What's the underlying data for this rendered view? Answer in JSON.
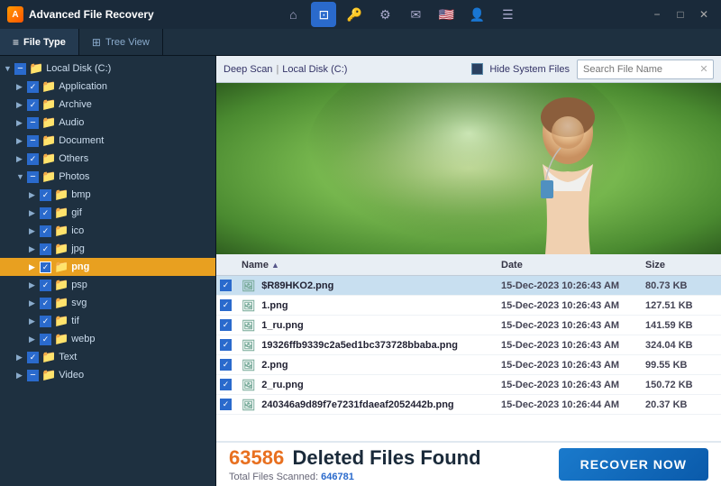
{
  "app": {
    "title": "Advanced File Recovery",
    "icon": "AFR"
  },
  "titlebar": {
    "nav": [
      {
        "name": "home-icon",
        "symbol": "⌂",
        "active": false
      },
      {
        "name": "scan-icon",
        "symbol": "⊡",
        "active": true
      },
      {
        "name": "key-icon",
        "symbol": "🔑",
        "active": false
      },
      {
        "name": "settings-icon",
        "symbol": "⚙",
        "active": false
      },
      {
        "name": "mail-icon",
        "symbol": "✉",
        "active": false
      }
    ],
    "win_controls": [
      "−",
      "□",
      "✕"
    ]
  },
  "tabs": [
    {
      "label": "File Type",
      "icon": "≡",
      "active": true
    },
    {
      "label": "Tree View",
      "icon": "⊞",
      "active": false
    }
  ],
  "toolbar": {
    "breadcrumb": [
      "Deep Scan",
      "Local Disk (C:)"
    ],
    "breadcrumb_sep": "|",
    "hide_sys_files_label": "Hide System Files",
    "search_placeholder": "Search File Name",
    "search_clear": "✕"
  },
  "tree": {
    "items": [
      {
        "id": "local-disk",
        "label": "Local Disk (C:)",
        "indent": 0,
        "expanded": true,
        "checked": "indeterminate",
        "type": "folder",
        "color": "yellow"
      },
      {
        "id": "application",
        "label": "Application",
        "indent": 1,
        "expanded": false,
        "checked": "checked",
        "type": "folder",
        "color": "yellow"
      },
      {
        "id": "archive",
        "label": "Archive",
        "indent": 1,
        "expanded": false,
        "checked": "checked",
        "type": "folder",
        "color": "yellow"
      },
      {
        "id": "audio",
        "label": "Audio",
        "indent": 1,
        "expanded": false,
        "checked": "indeterminate",
        "type": "folder",
        "color": "yellow"
      },
      {
        "id": "document",
        "label": "Document",
        "indent": 1,
        "expanded": false,
        "checked": "indeterminate",
        "type": "folder",
        "color": "yellow"
      },
      {
        "id": "others",
        "label": "Others",
        "indent": 1,
        "expanded": false,
        "checked": "checked",
        "type": "folder",
        "color": "yellow"
      },
      {
        "id": "photos",
        "label": "Photos",
        "indent": 1,
        "expanded": true,
        "checked": "indeterminate",
        "type": "folder",
        "color": "yellow"
      },
      {
        "id": "bmp",
        "label": "bmp",
        "indent": 2,
        "expanded": false,
        "checked": "checked",
        "type": "folder",
        "color": "yellow"
      },
      {
        "id": "gif",
        "label": "gif",
        "indent": 2,
        "expanded": false,
        "checked": "checked",
        "type": "folder",
        "color": "yellow"
      },
      {
        "id": "ico",
        "label": "ico",
        "indent": 2,
        "expanded": false,
        "checked": "checked",
        "type": "folder",
        "color": "yellow"
      },
      {
        "id": "jpg",
        "label": "jpg",
        "indent": 2,
        "expanded": false,
        "checked": "checked",
        "type": "folder",
        "color": "yellow"
      },
      {
        "id": "png",
        "label": "png",
        "indent": 2,
        "expanded": false,
        "checked": "checked",
        "type": "folder",
        "color": "orange",
        "selected": true,
        "highlighted": true
      },
      {
        "id": "psp",
        "label": "psp",
        "indent": 2,
        "expanded": false,
        "checked": "checked",
        "type": "folder",
        "color": "yellow"
      },
      {
        "id": "svg",
        "label": "svg",
        "indent": 2,
        "expanded": false,
        "checked": "checked",
        "type": "folder",
        "color": "yellow"
      },
      {
        "id": "tif",
        "label": "tif",
        "indent": 2,
        "expanded": false,
        "checked": "checked",
        "type": "folder",
        "color": "yellow"
      },
      {
        "id": "webp",
        "label": "webp",
        "indent": 2,
        "expanded": false,
        "checked": "checked",
        "type": "folder",
        "color": "yellow"
      },
      {
        "id": "text",
        "label": "Text",
        "indent": 1,
        "expanded": false,
        "checked": "checked",
        "type": "folder",
        "color": "yellow"
      },
      {
        "id": "video",
        "label": "Video",
        "indent": 1,
        "expanded": false,
        "checked": "indeterminate",
        "type": "folder",
        "color": "yellow"
      }
    ]
  },
  "file_list": {
    "columns": [
      {
        "id": "name",
        "label": "Name",
        "sort": "asc"
      },
      {
        "id": "date",
        "label": "Date"
      },
      {
        "id": "size",
        "label": "Size"
      }
    ],
    "files": [
      {
        "name": "$R89HKO2.png",
        "date": "15-Dec-2023 10:26:43 AM",
        "size": "80.73 KB",
        "checked": true,
        "selected": true
      },
      {
        "name": "1.png",
        "date": "15-Dec-2023 10:26:43 AM",
        "size": "127.51 KB",
        "checked": true,
        "selected": false
      },
      {
        "name": "1_ru.png",
        "date": "15-Dec-2023 10:26:43 AM",
        "size": "141.59 KB",
        "checked": true,
        "selected": false
      },
      {
        "name": "19326ffb9339c2a5ed1bc373728bbaba.png",
        "date": "15-Dec-2023 10:26:43 AM",
        "size": "324.04 KB",
        "checked": true,
        "selected": false
      },
      {
        "name": "2.png",
        "date": "15-Dec-2023 10:26:43 AM",
        "size": "99.55 KB",
        "checked": true,
        "selected": false
      },
      {
        "name": "2_ru.png",
        "date": "15-Dec-2023 10:26:43 AM",
        "size": "150.72 KB",
        "checked": true,
        "selected": false
      },
      {
        "name": "240346a9d89f7e7231fdaeaf2052442b.png",
        "date": "15-Dec-2023 10:26:44 AM",
        "size": "20.37 KB",
        "checked": true,
        "selected": false
      }
    ]
  },
  "footer": {
    "deleted_count": "63586",
    "deleted_label": "Deleted Files Found",
    "scanned_label": "Total Files Scanned:",
    "scanned_count": "646781",
    "recover_btn": "RECOVER NOW"
  }
}
